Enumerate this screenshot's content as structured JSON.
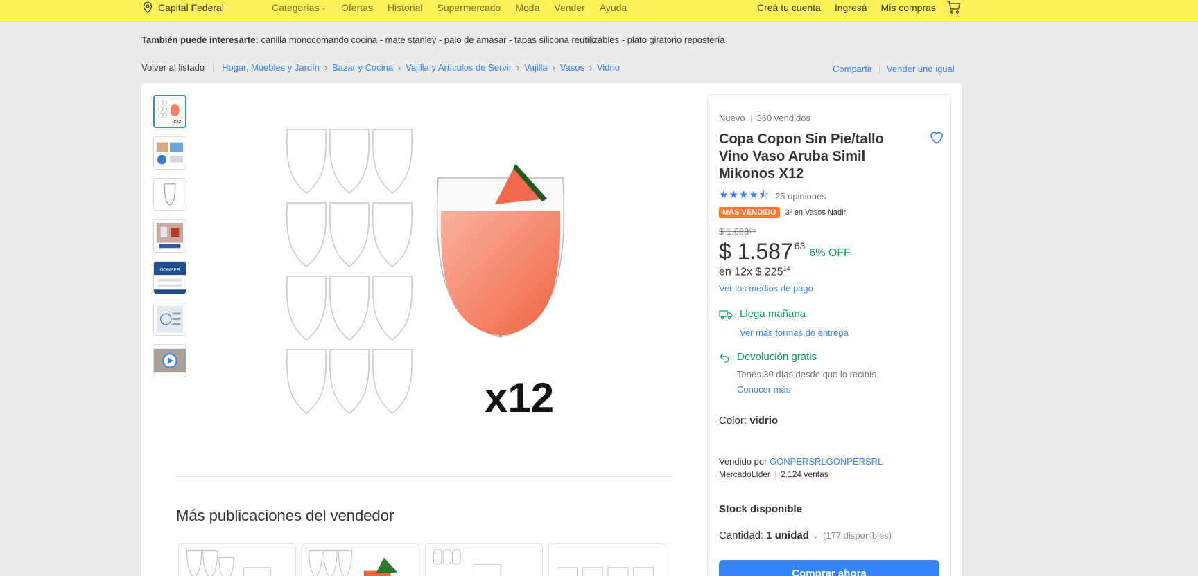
{
  "header": {
    "location": "Capital Federal",
    "nav": [
      {
        "label": "Categorías",
        "has_chevron": true
      },
      {
        "label": "Ofertas"
      },
      {
        "label": "Historial"
      },
      {
        "label": "Supermercado"
      },
      {
        "label": "Moda"
      },
      {
        "label": "Vender"
      },
      {
        "label": "Ayuda"
      }
    ],
    "account": [
      "Creá tu cuenta",
      "Ingresá",
      "Mis compras"
    ],
    "bg_color": "#fff159"
  },
  "interest": {
    "label": "También puede interesarte:",
    "items": "canilla monocomando cocina - mate stanley - palo de amasar - tapas silicona reutilizables - plato giratorio repostería"
  },
  "breadcrumb": {
    "back": "Volver al listado",
    "items": [
      "Hogar, Muebles y Jardín",
      "Bazar y Cocina",
      "Vajilla y Artículos de Servir",
      "Vajilla",
      "Vasos",
      "Vidrio"
    ],
    "share": "Compartir",
    "sell_same": "Vender uno igual"
  },
  "gallery": {
    "thumbnail_count": 7,
    "main_label": "x12"
  },
  "more": {
    "title": "Más publicaciones del vendedor"
  },
  "product": {
    "condition": "Nuevo",
    "sold": "360 vendidos",
    "title": "Copa Copon Sin Pie/tallo Vino Vaso Aruba Simil Mikonos X12",
    "rating": 4.5,
    "reviews": "25 opiniones",
    "badge": "MÁS VENDIDO",
    "rank": "3º en Vasos Nadir",
    "old_price": "$ 1.688⁹⁷",
    "price": "$ 1.587",
    "cents": "63",
    "discount": "6% OFF",
    "installments": "en 12x $ 225",
    "installments_cents": "14",
    "payment_link": "Ver los medios de pago",
    "shipping": "Llega mañana",
    "shipping_link": "Ver más formas de entrega",
    "returns": "Devolución gratis",
    "returns_sub": "Tenés 30 días desde que lo recibís.",
    "returns_link": "Conocer más",
    "color_label": "Color:",
    "color_value": "vidrio",
    "seller_label": "Vendido por",
    "seller_name": "GONPERSRLGONPERSRL",
    "seller_tier": "MercadoLíder",
    "seller_sales": "2.124 ventas",
    "stock": "Stock disponible",
    "qty_label": "Cantidad:",
    "qty_value": "1 unidad",
    "qty_available": "(177 disponibles)",
    "buy_button": "Comprar ahora"
  },
  "colors": {
    "accent": "#3483fa",
    "green": "#00a650",
    "badge": "#ff7733"
  }
}
